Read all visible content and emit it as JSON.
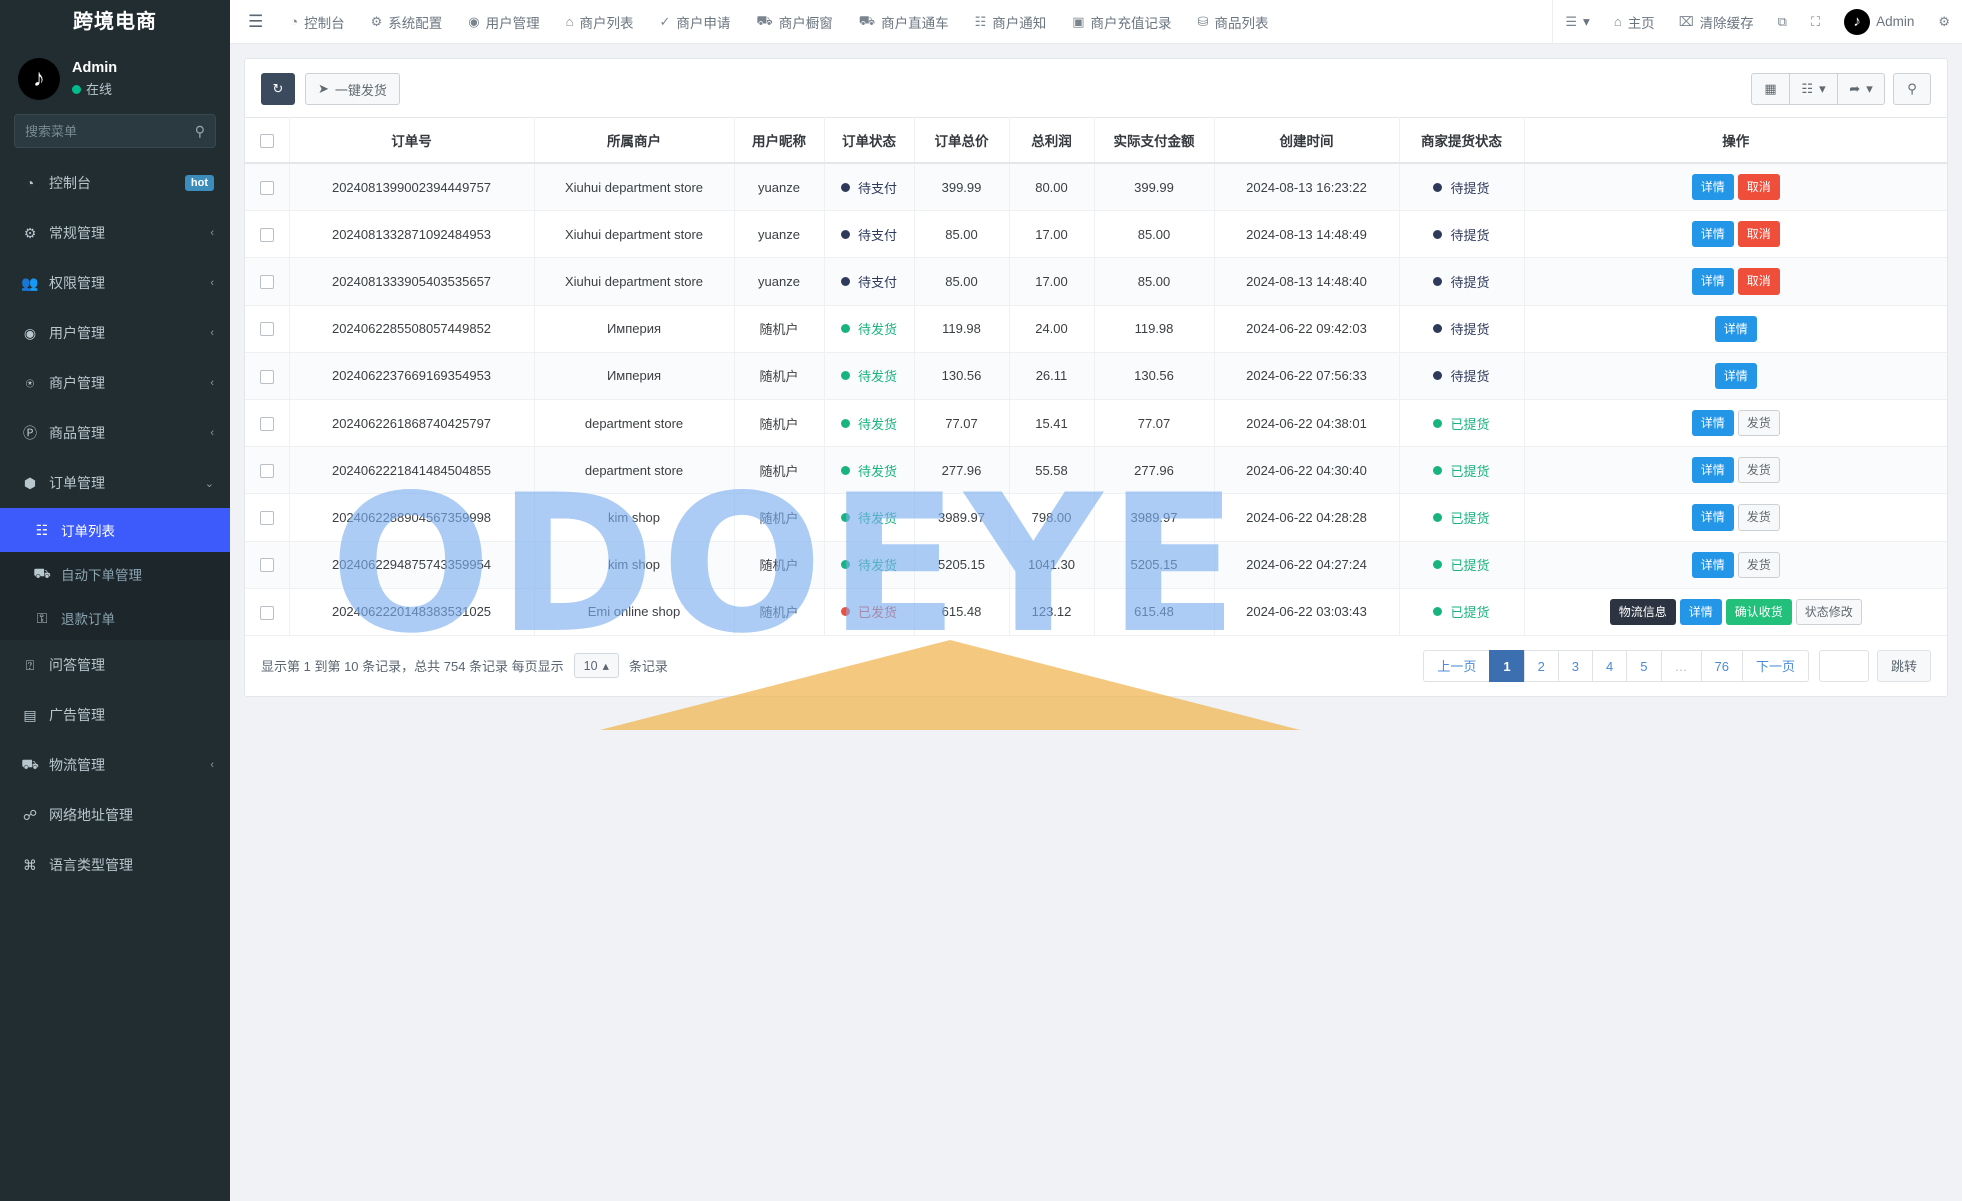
{
  "sidebar": {
    "brand": "跨境电商",
    "user": {
      "name": "Admin",
      "status": "在线",
      "avatar_icon": "tiktok-logo-icon"
    },
    "search": {
      "placeholder": "搜索菜单",
      "value": "",
      "icon": "search-icon"
    },
    "items": [
      {
        "label": "控制台",
        "icon": "dashboard-icon",
        "badge": "hot",
        "caret": ""
      },
      {
        "label": "常规管理",
        "icon": "gears-icon",
        "badge": "",
        "caret": "‹"
      },
      {
        "label": "权限管理",
        "icon": "users-group-icon",
        "badge": "",
        "caret": "‹"
      },
      {
        "label": "用户管理",
        "icon": "user-circle-icon",
        "badge": "",
        "caret": "‹"
      },
      {
        "label": "商户管理",
        "icon": "apple-icon",
        "badge": "",
        "caret": "‹"
      },
      {
        "label": "商品管理",
        "icon": "product-icon",
        "badge": "",
        "caret": "‹"
      },
      {
        "label": "订单管理",
        "icon": "cube-icon",
        "badge": "",
        "caret": "⌄",
        "expanded": true
      },
      {
        "label": "问答管理",
        "icon": "question-circle-icon",
        "badge": "",
        "caret": ""
      },
      {
        "label": "广告管理",
        "icon": "ad-icon",
        "badge": "",
        "caret": ""
      },
      {
        "label": "物流管理",
        "icon": "truck-icon",
        "badge": "",
        "caret": "‹"
      },
      {
        "label": "网络地址管理",
        "icon": "link-icon",
        "badge": "",
        "caret": ""
      },
      {
        "label": "语言类型管理",
        "icon": "language-icon",
        "badge": "",
        "caret": ""
      }
    ],
    "submenu": [
      {
        "label": "订单列表",
        "icon": "list-icon",
        "active": true
      },
      {
        "label": "自动下单管理",
        "icon": "car-icon",
        "active": false
      },
      {
        "label": "退款订单",
        "icon": "refund-lock-icon",
        "active": false
      }
    ]
  },
  "topnav": {
    "hamburger_icon": "hamburger-icon",
    "items": [
      {
        "label": "控制台",
        "icon": "dashboard-icon"
      },
      {
        "label": "系统配置",
        "icon": "gear-icon"
      },
      {
        "label": "用户管理",
        "icon": "user-icon"
      },
      {
        "label": "商户列表",
        "icon": "home-icon"
      },
      {
        "label": "商户申请",
        "icon": "check-circle-icon"
      },
      {
        "label": "商户橱窗",
        "icon": "cart-icon"
      },
      {
        "label": "商户直通车",
        "icon": "car-icon"
      },
      {
        "label": "商户通知",
        "icon": "notice-icon"
      },
      {
        "label": "商户充值记录",
        "icon": "record-icon"
      },
      {
        "label": "商品列表",
        "icon": "bag-icon"
      }
    ],
    "right": [
      {
        "label": "",
        "icon": "list-menu-icon",
        "caret": "▾"
      },
      {
        "label": "主页",
        "icon": "home-icon"
      },
      {
        "label": "清除缓存",
        "icon": "trash-icon"
      },
      {
        "label": "",
        "icon": "copy-icon"
      },
      {
        "label": "",
        "icon": "fullscreen-icon"
      },
      {
        "label": "Admin",
        "icon": "tiktok-avatar-icon"
      },
      {
        "label": "",
        "icon": "settings-gear-icon"
      }
    ]
  },
  "toolbar": {
    "refresh_icon": "refresh-icon",
    "bulk_ship_label": "一键发货",
    "bulk_ship_icon": "paper-plane-icon",
    "column_toggle_icon": "columns-icon",
    "grid_icon": "grid-icon",
    "export_icon": "export-icon",
    "search_icon": "search-icon",
    "caret": "▾"
  },
  "table": {
    "columns": [
      "",
      "订单号",
      "所属商户",
      "用户昵称",
      "订单状态",
      "订单总价",
      "总利润",
      "实际支付金额",
      "创建时间",
      "商家提货状态",
      "操作"
    ],
    "rows": [
      {
        "order_no": "2024081399002394449757",
        "merchant": "Xiuhui department store",
        "nickname": "yuanze",
        "order_status": "待支付",
        "order_status_color": "#2e3a5c",
        "total_price": "399.99",
        "profit": "80.00",
        "paid": "399.99",
        "created_at": "2024-08-13 16:23:22",
        "pickup_status": "待提货",
        "pickup_status_color": "#2e3a5c",
        "actions": [
          {
            "label": "详情",
            "style": "primary"
          },
          {
            "label": "取消",
            "style": "danger"
          }
        ]
      },
      {
        "order_no": "2024081332871092484953",
        "merchant": "Xiuhui department store",
        "nickname": "yuanze",
        "order_status": "待支付",
        "order_status_color": "#2e3a5c",
        "total_price": "85.00",
        "profit": "17.00",
        "paid": "85.00",
        "created_at": "2024-08-13 14:48:49",
        "pickup_status": "待提货",
        "pickup_status_color": "#2e3a5c",
        "actions": [
          {
            "label": "详情",
            "style": "primary"
          },
          {
            "label": "取消",
            "style": "danger"
          }
        ]
      },
      {
        "order_no": "2024081333905403535657",
        "merchant": "Xiuhui department store",
        "nickname": "yuanze",
        "order_status": "待支付",
        "order_status_color": "#2e3a5c",
        "total_price": "85.00",
        "profit": "17.00",
        "paid": "85.00",
        "created_at": "2024-08-13 14:48:40",
        "pickup_status": "待提货",
        "pickup_status_color": "#2e3a5c",
        "actions": [
          {
            "label": "详情",
            "style": "primary"
          },
          {
            "label": "取消",
            "style": "danger"
          }
        ]
      },
      {
        "order_no": "2024062285508057449852",
        "merchant": "Империя",
        "nickname": "随机户",
        "order_status": "待发货",
        "order_status_color": "#18b47e",
        "total_price": "119.98",
        "profit": "24.00",
        "paid": "119.98",
        "created_at": "2024-06-22 09:42:03",
        "pickup_status": "待提货",
        "pickup_status_color": "#2e3a5c",
        "actions": [
          {
            "label": "详情",
            "style": "primary"
          }
        ]
      },
      {
        "order_no": "2024062237669169354953",
        "merchant": "Империя",
        "nickname": "随机户",
        "order_status": "待发货",
        "order_status_color": "#18b47e",
        "total_price": "130.56",
        "profit": "26.11",
        "paid": "130.56",
        "created_at": "2024-06-22 07:56:33",
        "pickup_status": "待提货",
        "pickup_status_color": "#2e3a5c",
        "actions": [
          {
            "label": "详情",
            "style": "primary"
          }
        ]
      },
      {
        "order_no": "2024062261868740425797",
        "merchant": "department store",
        "nickname": "随机户",
        "order_status": "待发货",
        "order_status_color": "#18b47e",
        "total_price": "77.07",
        "profit": "15.41",
        "paid": "77.07",
        "created_at": "2024-06-22 04:38:01",
        "pickup_status": "已提货",
        "pickup_status_color": "#18b47e",
        "actions": [
          {
            "label": "详情",
            "style": "primary"
          },
          {
            "label": "发货",
            "style": "default"
          }
        ]
      },
      {
        "order_no": "2024062221841484504855",
        "merchant": "department store",
        "nickname": "随机户",
        "order_status": "待发货",
        "order_status_color": "#18b47e",
        "total_price": "277.96",
        "profit": "55.58",
        "paid": "277.96",
        "created_at": "2024-06-22 04:30:40",
        "pickup_status": "已提货",
        "pickup_status_color": "#18b47e",
        "actions": [
          {
            "label": "详情",
            "style": "primary"
          },
          {
            "label": "发货",
            "style": "default"
          }
        ]
      },
      {
        "order_no": "2024062288904567359998",
        "merchant": "kim shop",
        "nickname": "随机户",
        "order_status": "待发货",
        "order_status_color": "#18b47e",
        "total_price": "3989.97",
        "profit": "798.00",
        "paid": "3989.97",
        "created_at": "2024-06-22 04:28:28",
        "pickup_status": "已提货",
        "pickup_status_color": "#18b47e",
        "actions": [
          {
            "label": "详情",
            "style": "primary"
          },
          {
            "label": "发货",
            "style": "default"
          }
        ]
      },
      {
        "order_no": "2024062294875743359954",
        "merchant": "kim shop",
        "nickname": "随机户",
        "order_status": "待发货",
        "order_status_color": "#18b47e",
        "total_price": "5205.15",
        "profit": "1041.30",
        "paid": "5205.15",
        "created_at": "2024-06-22 04:27:24",
        "pickup_status": "已提货",
        "pickup_status_color": "#18b47e",
        "actions": [
          {
            "label": "详情",
            "style": "primary"
          },
          {
            "label": "发货",
            "style": "default"
          }
        ]
      },
      {
        "order_no": "2024062220148383531025",
        "merchant": "Emi online shop",
        "nickname": "随机户",
        "order_status": "已发货",
        "order_status_color": "#ef4e3b",
        "total_price": "615.48",
        "profit": "123.12",
        "paid": "615.48",
        "created_at": "2024-06-22 03:03:43",
        "pickup_status": "已提货",
        "pickup_status_color": "#18b47e",
        "actions": [
          {
            "label": "物流信息",
            "style": "dark"
          },
          {
            "label": "详情",
            "style": "primary"
          },
          {
            "label": "确认收货",
            "style": "success"
          },
          {
            "label": "状态修改",
            "style": "default"
          }
        ]
      }
    ]
  },
  "footer": {
    "info_prefix": "显示第 1 到第 10 条记录，总共 754 条记录 每页显示",
    "page_size": "10",
    "page_size_caret": "▴",
    "info_suffix": "条记录",
    "prev_label": "上一页",
    "next_label": "下一页",
    "pages": [
      "1",
      "2",
      "3",
      "4",
      "5",
      "…",
      "76"
    ],
    "current_page": "1",
    "jump_value": "",
    "jump_label": "跳转"
  },
  "watermark": {
    "text": "ODOEYE",
    "color": "#7aaef0",
    "accent_color": "#f0b34d"
  }
}
